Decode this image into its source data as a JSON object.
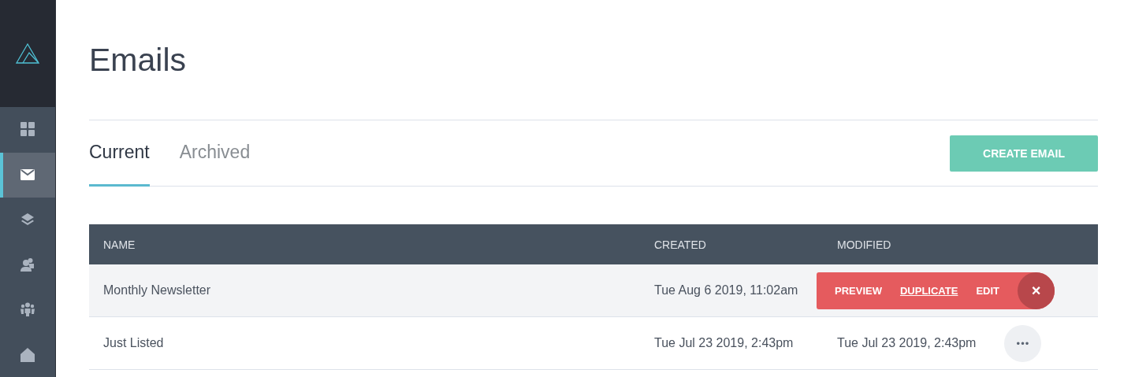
{
  "sidebar": {
    "items": [
      {
        "kind": "grid",
        "selected": false
      },
      {
        "kind": "mail",
        "selected": true
      },
      {
        "kind": "layers",
        "selected": false
      },
      {
        "kind": "users",
        "selected": false
      },
      {
        "kind": "group",
        "selected": false
      },
      {
        "kind": "home",
        "selected": false
      }
    ]
  },
  "page": {
    "title": "Emails"
  },
  "tabs": [
    {
      "label": "Current",
      "selected": true
    },
    {
      "label": "Archived",
      "selected": false
    }
  ],
  "create_button": "CREATE EMAIL",
  "table": {
    "columns": [
      "NAME",
      "CREATED",
      "MODIFIED"
    ],
    "rows": [
      {
        "name": "Monthly Newsletter",
        "created": "Tue Aug 6 2019, 11:02am",
        "menu_open": true,
        "actions": [
          {
            "label": "PREVIEW",
            "hovered": false
          },
          {
            "label": "DUPLICATE",
            "hovered": true
          },
          {
            "label": "EDIT",
            "hovered": false
          }
        ],
        "close": "×"
      },
      {
        "name": "Just Listed",
        "created": "Tue Jul 23 2019, 2:43pm",
        "modified": "Tue Jul 23 2019, 2:43pm",
        "menu_open": false,
        "more": "•••"
      }
    ]
  }
}
